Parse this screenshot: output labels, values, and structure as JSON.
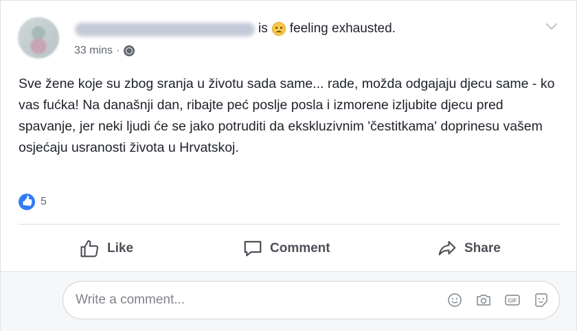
{
  "post": {
    "author_name": "Dragica Drugo Balanovic",
    "verb": "is",
    "activity": "feeling exhausted.",
    "time": "33 mins",
    "separator": "·",
    "text": "Sve žene koje su zbog sranja u životu sada same... rade, možda odgajaju djecu same - ko vas fućka! Na današnji dan, ribajte peć poslje posla i izmorene izljubite djecu pred spavanje, jer neki ljudi će se jako potruditi da ekskluzivnim 'čestitkama' doprinesu vašem osjećaju usranosti života u Hrvatskoj.",
    "reaction_count": "5"
  },
  "actions": {
    "like": "Like",
    "comment": "Comment",
    "share": "Share"
  },
  "composer": {
    "placeholder": "Write a comment..."
  },
  "icons": {
    "audience": "globe-icon",
    "feeling": "exhausted-emoji-icon",
    "menu": "chevron-down-icon",
    "emoji": "smiley-icon",
    "photo": "camera-icon",
    "gif": "gif-icon",
    "sticker": "sticker-icon"
  },
  "colors": {
    "like_blue": "#2f7cf6",
    "text": "#1d2129",
    "muted": "#616770"
  }
}
